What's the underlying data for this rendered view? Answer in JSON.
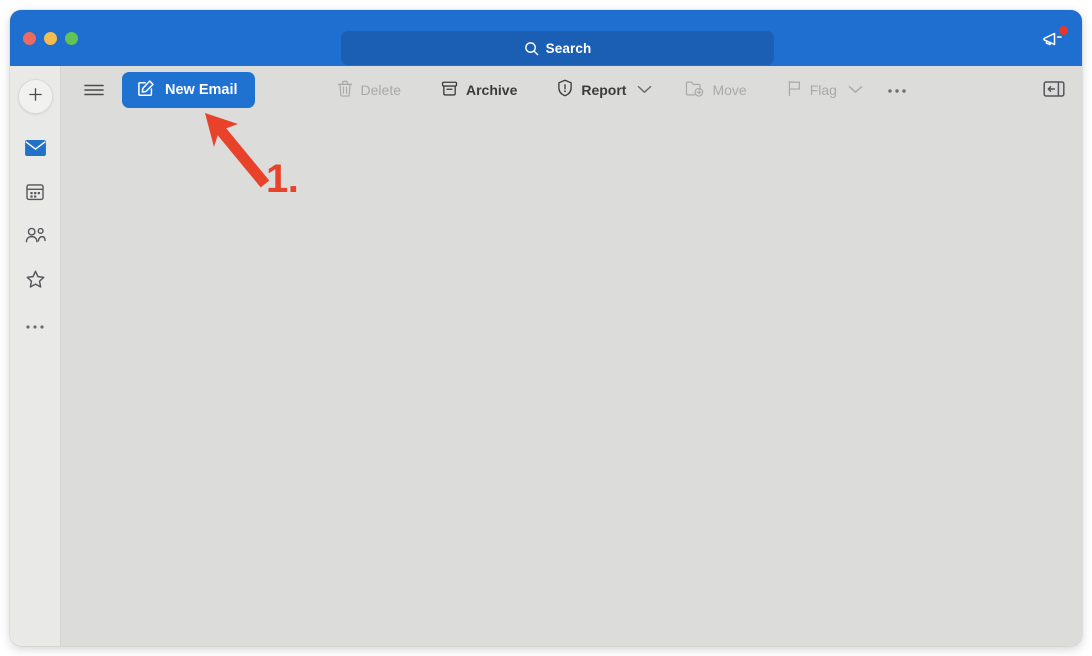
{
  "window": {
    "titlebar": {
      "traffic_lights": [
        {
          "name": "close",
          "color": "#ec6a5f"
        },
        {
          "name": "minimize",
          "color": "#f4bd4f"
        },
        {
          "name": "maximize",
          "color": "#61c454"
        }
      ],
      "search": {
        "icon": "search-icon",
        "placeholder": "Search",
        "value": ""
      },
      "announcement": {
        "icon": "megaphone-icon",
        "has_notification": true,
        "notification_color": "#e8362a"
      },
      "background_color": "#1f6fd0"
    },
    "rail": {
      "add_button": {
        "icon": "plus-icon",
        "label": ""
      },
      "items": [
        {
          "name": "mail",
          "icon": "mail-icon",
          "active": true,
          "color": "#2272c8"
        },
        {
          "name": "calendar",
          "icon": "calendar-icon",
          "active": false,
          "color": "#55555a"
        },
        {
          "name": "people",
          "icon": "people-icon",
          "active": false,
          "color": "#55555a"
        },
        {
          "name": "favorites",
          "icon": "star-icon",
          "active": false,
          "color": "#55555a"
        },
        {
          "name": "more",
          "icon": "ellipsis-icon",
          "active": false,
          "color": "#6e6e6c"
        }
      ]
    },
    "toolbar": {
      "menu_icon": "hamburger-icon",
      "new_email": {
        "label": "New Email",
        "icon": "compose-icon",
        "color": "#1f72d0"
      },
      "actions": [
        {
          "label": "Delete",
          "icon": "trash-icon",
          "enabled": false,
          "has_chevron": false
        },
        {
          "label": "Archive",
          "icon": "archive-icon",
          "enabled": true,
          "has_chevron": false
        },
        {
          "label": "Report",
          "icon": "shield-alert-icon",
          "enabled": true,
          "has_chevron": true
        },
        {
          "label": "Move",
          "icon": "folder-move-icon",
          "enabled": false,
          "has_chevron": false
        },
        {
          "label": "Flag",
          "icon": "flag-icon",
          "enabled": false,
          "has_chevron": true
        }
      ],
      "overflow": {
        "label": "•••",
        "icon": "ellipsis-icon"
      },
      "panel_toggle": {
        "icon": "panel-collapse-icon"
      }
    },
    "content": {
      "empty": true,
      "background_color": "#dcdcda"
    }
  },
  "annotation": {
    "step_label": "1.",
    "color": "#e8432a",
    "arrow": {
      "points_to": "new-email-button"
    }
  }
}
